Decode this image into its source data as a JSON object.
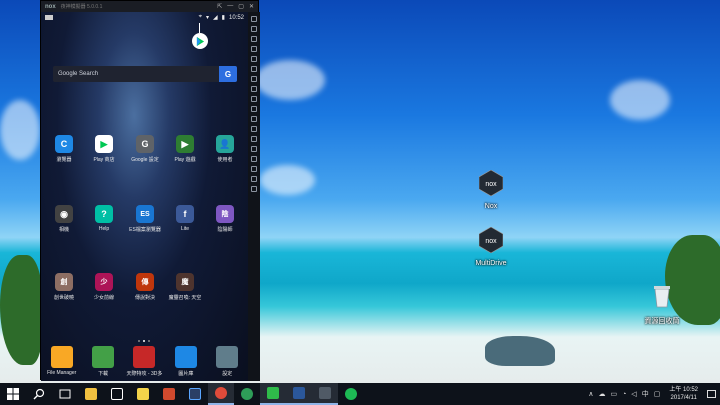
{
  "nox": {
    "logo": "nox",
    "title": "夜神模擬器 5.0.0.1",
    "window_controls": [
      "⇱",
      "—",
      "▢",
      "✕"
    ]
  },
  "android": {
    "status_time": "10:52",
    "search_label": "Google Search",
    "search_btn": "G",
    "apps": [
      {
        "label": "瀏覽器",
        "color": "#1e88e5",
        "icon": "browser-icon",
        "glyph": "C"
      },
      {
        "label": "Play 商店",
        "color": "#ffffff",
        "icon": "play-store-icon",
        "glyph": "▶"
      },
      {
        "label": "Google 設定",
        "color": "#5f6368",
        "icon": "google-settings-icon",
        "glyph": "G"
      },
      {
        "label": "Play 遊戲",
        "color": "#2e7d32",
        "icon": "play-games-icon",
        "glyph": "▶"
      },
      {
        "label": "使用者",
        "color": "#26a69a",
        "icon": "contacts-icon",
        "glyph": "👤"
      },
      {
        "label": "相機",
        "color": "#424242",
        "icon": "camera-icon",
        "glyph": "◉"
      },
      {
        "label": "Help",
        "color": "#00bfa5",
        "icon": "help-icon",
        "glyph": "?"
      },
      {
        "label": "ES檔案瀏覽器",
        "color": "#1976d2",
        "icon": "es-file-icon",
        "glyph": "ES"
      },
      {
        "label": "Lite",
        "color": "#3b5998",
        "icon": "facebook-lite-icon",
        "glyph": "f"
      },
      {
        "label": "陰陽師",
        "color": "#7e57c2",
        "icon": "onmyoji-icon",
        "glyph": "陰"
      },
      {
        "label": "創世破曉",
        "color": "#8d6e63",
        "icon": "game-icon-1",
        "glyph": "創"
      },
      {
        "label": "少女前線",
        "color": "#ad1457",
        "icon": "game-icon-2",
        "glyph": "少"
      },
      {
        "label": "傳說對決",
        "color": "#bf360c",
        "icon": "game-icon-3",
        "glyph": "傳"
      },
      {
        "label": "魔靈召喚: 天空",
        "color": "#4e342e",
        "icon": "game-icon-4",
        "glyph": "魔"
      }
    ],
    "dock": [
      {
        "label": "File Manager",
        "color": "#f9a825",
        "icon": "folder-icon"
      },
      {
        "label": "下載",
        "color": "#43a047",
        "icon": "download-icon"
      },
      {
        "label": "天際特攻 - 3D多",
        "color": "#c62828",
        "icon": "game-dock-icon"
      },
      {
        "label": "圖片庫",
        "color": "#1e88e5",
        "icon": "gallery-icon"
      },
      {
        "label": "設定",
        "color": "#607d8b",
        "icon": "settings-icon"
      }
    ]
  },
  "desktop": {
    "icons": [
      {
        "label": "Nox",
        "icon": "nox-icon"
      },
      {
        "label": "MultiDrive",
        "icon": "multidrive-icon"
      },
      {
        "label": "資源回收筒",
        "icon": "recycle-bin-icon"
      }
    ]
  },
  "taskbar": {
    "items": [
      {
        "icon": "windows-start-icon",
        "color": "#ffffff"
      },
      {
        "icon": "search-icon",
        "color": "#ffffff"
      },
      {
        "icon": "task-view-icon",
        "color": "#ffffff"
      },
      {
        "icon": "file-explorer-icon",
        "color": "#f0c040"
      },
      {
        "icon": "store-icon",
        "color": "#ffffff"
      },
      {
        "icon": "sticky-notes-icon",
        "color": "#f3d34a"
      },
      {
        "icon": "remote-icon",
        "color": "#d04a2e"
      },
      {
        "icon": "photoshop-icon",
        "color": "#2a3f66"
      },
      {
        "icon": "chrome-icon",
        "color": "#e04b3a"
      },
      {
        "icon": "hangouts-icon",
        "color": "#2e9e58"
      },
      {
        "icon": "line-icon",
        "color": "#2fbb4a"
      },
      {
        "icon": "word-icon",
        "color": "#2b579a"
      },
      {
        "icon": "nox-taskbar-icon",
        "color": "#505a66"
      },
      {
        "icon": "spotify-icon",
        "color": "#1db954"
      }
    ],
    "tray_ime": "中",
    "clock_time": "上午 10:52",
    "clock_date": "2017/4/11"
  }
}
